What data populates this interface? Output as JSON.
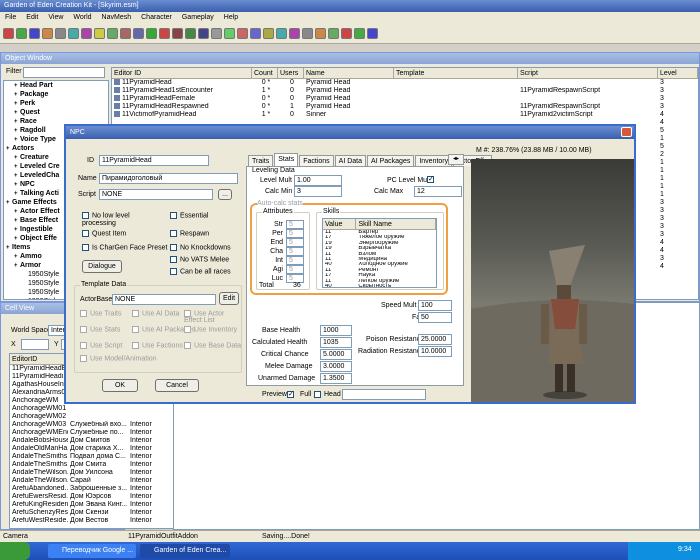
{
  "app": {
    "title": "Garden of Eden Creation Kit - [Skyrim.esm]"
  },
  "menu": [
    "File",
    "Edit",
    "View",
    "World",
    "NavMesh",
    "Character",
    "Gameplay",
    "Help"
  ],
  "object_window": {
    "title": "Object Window",
    "filter_label": "Filter",
    "tree": [
      {
        "label": "Head Part",
        "indent": 1,
        "bold": true
      },
      {
        "label": "Package",
        "indent": 1,
        "bold": true
      },
      {
        "label": "Perk",
        "indent": 1,
        "bold": true
      },
      {
        "label": "Quest",
        "indent": 1,
        "bold": true
      },
      {
        "label": "Race",
        "indent": 1,
        "bold": true
      },
      {
        "label": "Ragdoll",
        "indent": 1,
        "bold": true
      },
      {
        "label": "Voice Type",
        "indent": 1,
        "bold": true
      },
      {
        "label": "Actors",
        "indent": 0,
        "bold": true
      },
      {
        "label": "Creature",
        "indent": 1,
        "bold": true
      },
      {
        "label": "Leveled Cre",
        "indent": 1,
        "bold": true
      },
      {
        "label": "LeveledCha",
        "indent": 1,
        "bold": true
      },
      {
        "label": "NPC",
        "indent": 1,
        "bold": true
      },
      {
        "label": "Talking Acti",
        "indent": 1,
        "bold": true
      },
      {
        "label": "Game Effects",
        "indent": 0,
        "bold": true
      },
      {
        "label": "Actor Effect",
        "indent": 1,
        "bold": true
      },
      {
        "label": "Base Effect",
        "indent": 1,
        "bold": true
      },
      {
        "label": "Ingestible",
        "indent": 1,
        "bold": true
      },
      {
        "label": "Object Effe",
        "indent": 1,
        "bold": true
      },
      {
        "label": "Items",
        "indent": 0,
        "bold": true
      },
      {
        "label": "Ammo",
        "indent": 1,
        "bold": true
      },
      {
        "label": "Armor",
        "indent": 1,
        "bold": true
      },
      {
        "label": "1950Style",
        "indent": 2,
        "bold": false
      },
      {
        "label": "1950Style",
        "indent": 2,
        "bold": false
      },
      {
        "label": "1950Style",
        "indent": 2,
        "bold": false
      },
      {
        "label": "1950Style",
        "indent": 2,
        "bold": false
      }
    ],
    "columns": [
      "Editor ID",
      "Count",
      "Users",
      "Name",
      "Template",
      "Script",
      "Level"
    ],
    "rows": [
      {
        "id": "11PyramidHead",
        "count": "0 *",
        "users": "0",
        "name": "Pyramid Head",
        "template": "",
        "script": "",
        "level": "3"
      },
      {
        "id": "11PyramidHead1stEncounter",
        "count": "1 *",
        "users": "0",
        "name": "Pyramid Head",
        "template": "",
        "script": "11PyramidRespawnScript",
        "level": "3"
      },
      {
        "id": "11PyramidHeadFemale",
        "count": "0 *",
        "users": "0",
        "name": "Pyramid Head",
        "template": "",
        "script": "",
        "level": "3"
      },
      {
        "id": "11PyramidHeadRespawned",
        "count": "0 *",
        "users": "1",
        "name": "Pyramid Head",
        "template": "",
        "script": "11PyramidRespawnScript",
        "level": "3"
      },
      {
        "id": "11VictimofPyramidHead",
        "count": "1 *",
        "users": "0",
        "name": "Sinner",
        "template": "",
        "script": "11Pyramid2victimScript",
        "level": "4"
      },
      {
        "id": "",
        "count": "",
        "users": "",
        "name": "",
        "template": "",
        "script": "",
        "level": "4"
      },
      {
        "id": "",
        "count": "",
        "users": "",
        "name": "",
        "template": "",
        "script": "",
        "level": "5"
      },
      {
        "id": "",
        "count": "",
        "users": "",
        "name": "",
        "template": "",
        "script": "",
        "level": "1"
      },
      {
        "id": "",
        "count": "",
        "users": "",
        "name": "",
        "template": "",
        "script": "",
        "level": "5"
      },
      {
        "id": "",
        "count": "",
        "users": "",
        "name": "",
        "template": "",
        "script": "",
        "level": "2"
      },
      {
        "id": "",
        "count": "",
        "users": "",
        "name": "",
        "template": "",
        "script": "",
        "level": "1"
      },
      {
        "id": "",
        "count": "",
        "users": "",
        "name": "",
        "template": "",
        "script": "",
        "level": "1"
      },
      {
        "id": "",
        "count": "",
        "users": "",
        "name": "",
        "template": "",
        "script": "",
        "level": "1"
      },
      {
        "id": "",
        "count": "",
        "users": "",
        "name": "",
        "template": "",
        "script": "",
        "level": "1"
      },
      {
        "id": "",
        "count": "",
        "users": "",
        "name": "",
        "template": "",
        "script": "",
        "level": "1"
      },
      {
        "id": "",
        "count": "",
        "users": "",
        "name": "",
        "template": "",
        "script": "",
        "level": "3"
      },
      {
        "id": "",
        "count": "",
        "users": "",
        "name": "",
        "template": "",
        "script": "",
        "level": "3"
      },
      {
        "id": "",
        "count": "",
        "users": "",
        "name": "",
        "template": "",
        "script": "",
        "level": "3"
      },
      {
        "id": "",
        "count": "",
        "users": "",
        "name": "",
        "template": "",
        "script": "",
        "level": "3"
      },
      {
        "id": "",
        "count": "",
        "users": "",
        "name": "",
        "template": "",
        "script": "",
        "level": "3"
      },
      {
        "id": "",
        "count": "",
        "users": "",
        "name": "",
        "template": "",
        "script": "",
        "level": "4"
      },
      {
        "id": "",
        "count": "",
        "users": "",
        "name": "",
        "template": "",
        "script": "",
        "level": "4"
      },
      {
        "id": "",
        "count": "",
        "users": "",
        "name": "",
        "template": "",
        "script": "",
        "level": "3"
      },
      {
        "id": "",
        "count": "",
        "users": "",
        "name": "",
        "template": "",
        "script": "",
        "level": "4"
      }
    ]
  },
  "cell_view": {
    "title": "Cell View",
    "world_space_label": "World Space",
    "world_space_value": "Inter",
    "x_label": "X",
    "y_label": "Y",
    "column": "EditorID",
    "rows": [
      {
        "id": "11PyramidHeadE...",
        "name": "",
        "type": ""
      },
      {
        "id": "11PyramidHeadi...",
        "name": "",
        "type": ""
      },
      {
        "id": "AgathasHouseInt...",
        "name": "",
        "type": ""
      },
      {
        "id": "AlexandriaArms01",
        "name": "",
        "type": ""
      },
      {
        "id": "AnchorageWM",
        "name": "",
        "type": ""
      },
      {
        "id": "AnchorageWM01",
        "name": "",
        "type": ""
      },
      {
        "id": "AnchorageWM02",
        "name": "",
        "type": ""
      },
      {
        "id": "AnchorageWM03",
        "name": "Служебный вхо...",
        "type": "Interior"
      },
      {
        "id": "AnchorageWMEnd",
        "name": "Служебные по...",
        "type": "Interior"
      },
      {
        "id": "AndaleBobsHouse",
        "name": "Дом Смитов",
        "type": "Interior"
      },
      {
        "id": "AndaleOldManHa...",
        "name": "Дом старика Х...",
        "type": "Interior"
      },
      {
        "id": "AndaleTheSmiths...",
        "name": "Подвал дома С...",
        "type": "Interior"
      },
      {
        "id": "AndaleTheSmiths...",
        "name": "Дом Смита",
        "type": "Interior"
      },
      {
        "id": "AndaleTheWilson...",
        "name": "Дом Уилсона",
        "type": "Interior"
      },
      {
        "id": "AndaleTheWilson...",
        "name": "Сарай",
        "type": "Interior"
      },
      {
        "id": "ArefuAbandoned...",
        "name": "Заброшенные з...",
        "type": "Interior"
      },
      {
        "id": "ArefuEwersResid...",
        "name": "Дом Юэрсов",
        "type": "Interior"
      },
      {
        "id": "ArefuKingResiden...",
        "name": "Дом Эвана Кинг...",
        "type": "Interior"
      },
      {
        "id": "ArefuSchenzyRes...",
        "name": "Дом Скензи",
        "type": "Interior"
      },
      {
        "id": "ArefuWestReside...",
        "name": "Дом Вестов",
        "type": "Interior"
      }
    ]
  },
  "status": {
    "left": "Camera",
    "mid": "11PyramidOutfitAddon",
    "right": "Saving....Done!"
  },
  "npc": {
    "title": "NPC",
    "id_label": "ID",
    "id_value": "11PyramidHead",
    "name_label": "Name",
    "name_value": "Пирамидоголовый",
    "script_label": "Script",
    "script_value": "NONE",
    "checks": [
      {
        "label": "No low level processing",
        "checked": false
      },
      {
        "label": "Essential",
        "checked": false
      },
      {
        "label": "Quest Item",
        "checked": false
      },
      {
        "label": "Respawn",
        "checked": false
      },
      {
        "label": "Is CharGen Face Preset",
        "checked": false
      },
      {
        "label": "No Knockdowns",
        "checked": false
      },
      {
        "label": "No VATS Melee",
        "checked": false
      },
      {
        "label": "Can be all races",
        "checked": false
      }
    ],
    "dialogue_btn": "Dialogue",
    "template_data_label": "Template Data",
    "actorbase_label": "ActorBase",
    "actorbase_value": "NONE",
    "edit_btn": "Edit",
    "template_checks": [
      "Use Traits",
      "Use AI Data",
      "Use Actor Effect List",
      "Use Stats",
      "Use AI Packages",
      "Use Inventory",
      "Use Script",
      "Use Factions",
      "Use Base Data",
      "Use Model/Animation"
    ],
    "ok": "OK",
    "cancel": "Cancel",
    "tabs": [
      "Traits",
      "Stats",
      "Factions",
      "AI Data",
      "AI Packages",
      "Inventory",
      "Actor Effe"
    ],
    "active_tab": "Stats",
    "leveling_label": "Leveling Data",
    "level_mult_label": "Level Mult",
    "level_mult_value": "1.00",
    "pc_level_mult_label": "PC Level Mult",
    "calc_min_label": "Calc Min",
    "calc_min_value": "3",
    "calc_max_label": "Calc Max",
    "calc_max_value": "12",
    "auto_calc_label": "Auto-calc stats",
    "attributes_label": "Attributes",
    "attributes": [
      {
        "label": "Str",
        "value": "5"
      },
      {
        "label": "Per",
        "value": "5"
      },
      {
        "label": "End",
        "value": "5"
      },
      {
        "label": "Cha",
        "value": "5"
      },
      {
        "label": "Int",
        "value": "5"
      },
      {
        "label": "Agi",
        "value": "5"
      },
      {
        "label": "Luc",
        "value": "5"
      }
    ],
    "total_label": "Total",
    "total_value": "36",
    "skills_label": "Skills",
    "skills_cols": [
      "Value",
      "Skill Name"
    ],
    "skills": [
      {
        "v": "11",
        "n": "Бартер"
      },
      {
        "v": "17",
        "n": "Тяжелое оружие"
      },
      {
        "v": "19",
        "n": "Энергооружие"
      },
      {
        "v": "19",
        "n": "Взрывчатка"
      },
      {
        "v": "11",
        "n": "Взлом"
      },
      {
        "v": "11",
        "n": "Медицина"
      },
      {
        "v": "40",
        "n": "Холодное оружие"
      },
      {
        "v": "11",
        "n": "Ремонт"
      },
      {
        "v": "17",
        "n": "Наука"
      },
      {
        "v": "11",
        "n": "Легкое оружие"
      },
      {
        "v": "40",
        "n": "Скрытность"
      }
    ],
    "base_health_label": "Base Health",
    "base_health_value": "1000",
    "speed_mult_label": "Speed Mult %",
    "speed_mult_value": "100",
    "calc_health_label": "Calculated Health",
    "calc_health_value": "1035",
    "fatigue_label": "Fatigue",
    "fatigue_value": "50",
    "critical_label": "Critical Chance",
    "critical_value": "5.0000",
    "melee_label": "Melee Damage",
    "melee_value": "3.0000",
    "poison_label": "Poison Resistance",
    "poison_value": "25.0000",
    "unarmed_label": "Unarmed Damage",
    "unarmed_value": "1.3500",
    "radiation_label": "Radiation Resistance",
    "radiation_value": "10.0000",
    "preview_label": "Preview",
    "full_label": "Full",
    "head_label": "Head",
    "memory": "M #: 238.76% (23.88 MB / 10.00 MB)"
  },
  "taskbar": {
    "task1": "Переводчик Google ...",
    "task2": "Garden of Eden Crea...",
    "clock": "9:34"
  },
  "colors": {
    "orange_highlight": "#f0a040",
    "title_blue": "#3a5fae"
  }
}
